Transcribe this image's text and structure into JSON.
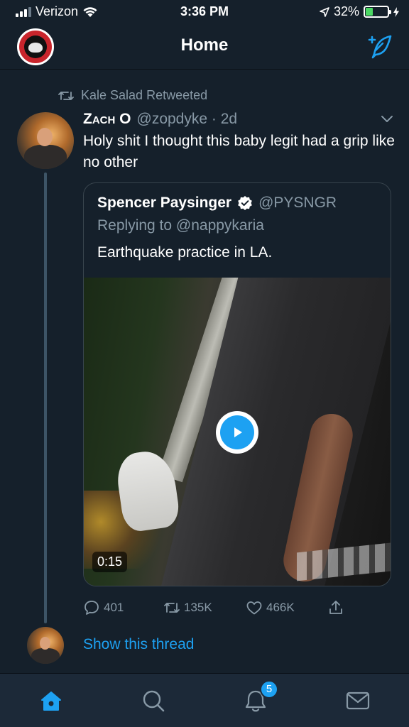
{
  "status_bar": {
    "carrier": "Verizon",
    "time": "3:36 PM",
    "battery_percent": "32%",
    "battery_level": 0.32,
    "signal_bars": 3
  },
  "header": {
    "title": "Home"
  },
  "tweet": {
    "retweeted_by": "Kale Salad Retweeted",
    "author_name": "Zach O",
    "author_handle_time": "@zopdyke · 2d",
    "text": "Holy shit I thought this baby legit had a grip like no other",
    "quoted": {
      "author_name": "Spencer Paysinger",
      "author_handle": "@PYSNGR",
      "replying_to": "Replying to @nappykaria",
      "text": "Earthquake practice in LA.",
      "video_duration": "0:15"
    },
    "actions": {
      "replies": "401",
      "retweets": "135K",
      "likes": "466K"
    },
    "show_thread": "Show this thread"
  },
  "tab_bar": {
    "notifications_badge": "5"
  },
  "colors": {
    "background": "#15202b",
    "accent": "#1da1f2",
    "secondary_text": "#8899a6",
    "tab_bar": "#1c2938"
  }
}
